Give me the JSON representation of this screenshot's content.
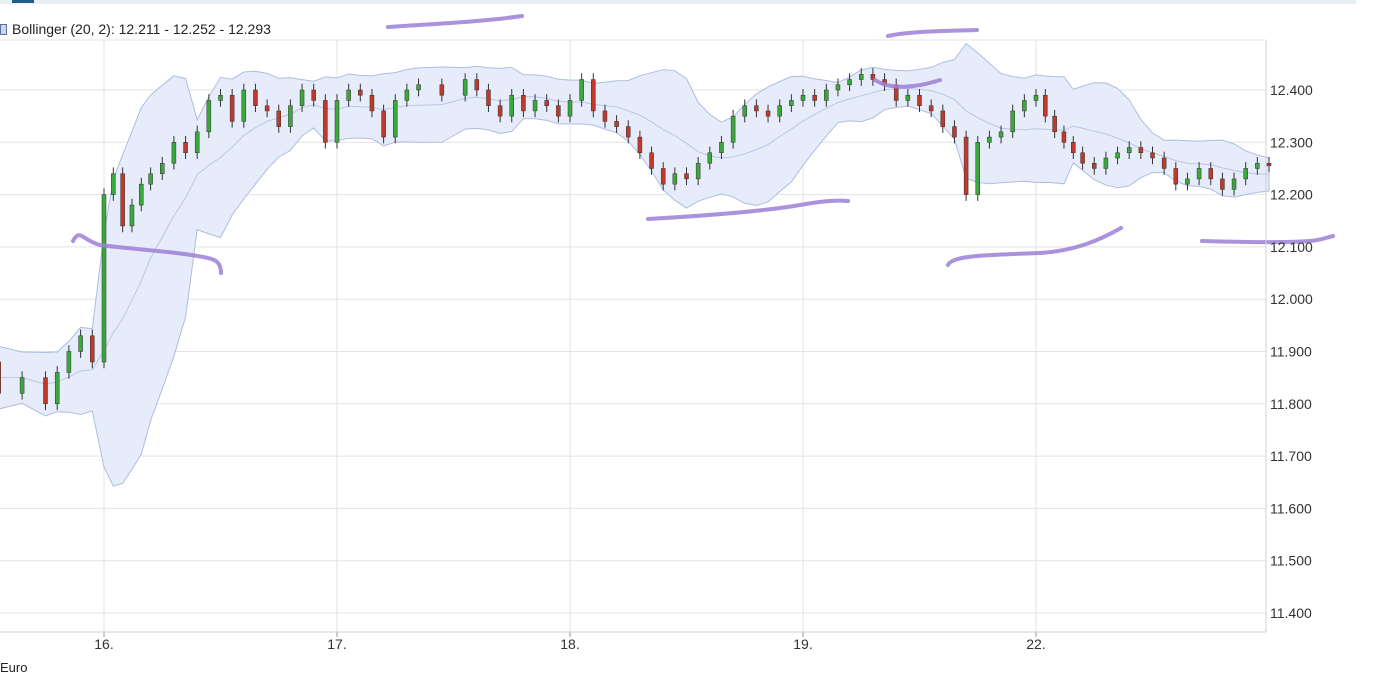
{
  "legend": {
    "label": "Bollinger (20, 2): 12.211 - 12.252 - 12.293",
    "swatch_color": "#c9d6f0"
  },
  "unit_label": "Euro",
  "colors": {
    "up": "#3aa83a",
    "down": "#c0392b",
    "band_fill": "#e6ecfa",
    "band_line": "#a9bbdf",
    "grid": "#e3e3e3",
    "annotation": "#9b7fd6"
  },
  "chart_data": {
    "type": "candlestick",
    "title": "",
    "xlabel": "",
    "ylabel": "",
    "ylim": [
      11.35,
      12.495
    ],
    "y_ticks": [
      11.4,
      11.5,
      11.6,
      11.7,
      11.8,
      11.9,
      12.0,
      12.1,
      12.2,
      12.3,
      12.4
    ],
    "y_tick_labels": [
      "11.400",
      "11.500",
      "11.600",
      "11.700",
      "11.800",
      "11.900",
      "12.000",
      "12.100",
      "12.200",
      "12.300",
      "12.400"
    ],
    "x_ticks": [
      "16.",
      "17.",
      "18.",
      "19.",
      "22."
    ],
    "grid": true,
    "y_axis_position": "right",
    "bollinger": {
      "period": 20,
      "std": 2,
      "last_lower": 12.211,
      "last_middle": 12.252,
      "last_upper": 12.293
    },
    "series": [
      {
        "x": [
          15.42,
          15.55,
          15.65,
          15.75,
          15.8,
          15.85,
          15.9,
          15.95,
          16.0,
          16.04,
          16.08,
          16.12,
          16.16,
          16.2,
          16.25,
          16.3,
          16.35,
          16.4,
          16.45,
          16.5,
          16.55,
          16.6,
          16.65,
          16.7,
          16.75,
          16.8,
          16.85,
          16.9,
          16.95,
          17.0,
          17.05,
          17.1,
          17.15,
          17.2,
          17.25,
          17.3,
          17.35,
          17.45,
          17.55,
          17.6,
          17.65,
          17.7,
          17.75,
          17.8,
          17.85,
          17.9,
          17.95,
          18.0,
          18.05,
          18.1,
          18.15,
          18.2,
          18.25,
          18.3,
          18.35,
          18.4,
          18.45,
          18.5,
          18.55,
          18.6,
          18.65,
          18.7,
          18.75,
          18.8,
          18.85,
          18.9,
          18.95,
          19.0,
          19.05,
          19.1,
          19.15,
          19.2,
          19.25,
          19.3,
          19.35,
          19.4,
          19.45,
          19.5,
          19.55,
          19.6,
          19.65,
          19.7,
          19.75,
          19.8,
          19.85,
          19.9,
          19.95,
          20.0,
          20.04,
          20.08,
          20.12,
          20.16,
          20.2,
          20.25,
          20.3,
          20.35,
          20.4,
          20.45,
          20.5,
          20.55,
          20.6,
          20.65,
          20.7,
          20.75,
          20.8,
          20.85,
          20.9,
          20.95,
          21.0
        ],
        "y": [
          11.88,
          11.82,
          11.85,
          11.8,
          11.86,
          11.9,
          11.93,
          11.88,
          12.2,
          12.24,
          12.14,
          12.18,
          12.22,
          12.24,
          12.26,
          12.3,
          12.28,
          12.32,
          12.38,
          12.39,
          12.34,
          12.4,
          12.37,
          12.36,
          12.33,
          12.37,
          12.4,
          12.38,
          12.3,
          12.38,
          12.4,
          12.39,
          12.36,
          12.31,
          12.38,
          12.4,
          12.41,
          12.39,
          12.42,
          12.4,
          12.37,
          12.35,
          12.39,
          12.36,
          12.38,
          12.37,
          12.35,
          12.38,
          12.42,
          12.36,
          12.34,
          12.33,
          12.31,
          12.28,
          12.25,
          12.22,
          12.24,
          12.23,
          12.26,
          12.28,
          12.3,
          12.35,
          12.37,
          12.36,
          12.35,
          12.37,
          12.38,
          12.39,
          12.38,
          12.4,
          12.41,
          12.42,
          12.43,
          12.42,
          12.41,
          12.38,
          12.39,
          12.37,
          12.36,
          12.33,
          12.31,
          12.2,
          12.3,
          12.31,
          12.32,
          12.36,
          12.38,
          12.39,
          12.35,
          12.32,
          12.3,
          12.28,
          12.26,
          12.25,
          12.27,
          12.28,
          12.29,
          12.28,
          12.27,
          12.25,
          12.22,
          12.23,
          12.25,
          12.23,
          12.21,
          12.23,
          12.25,
          12.26,
          12.255
        ],
        "name": ""
      }
    ]
  }
}
